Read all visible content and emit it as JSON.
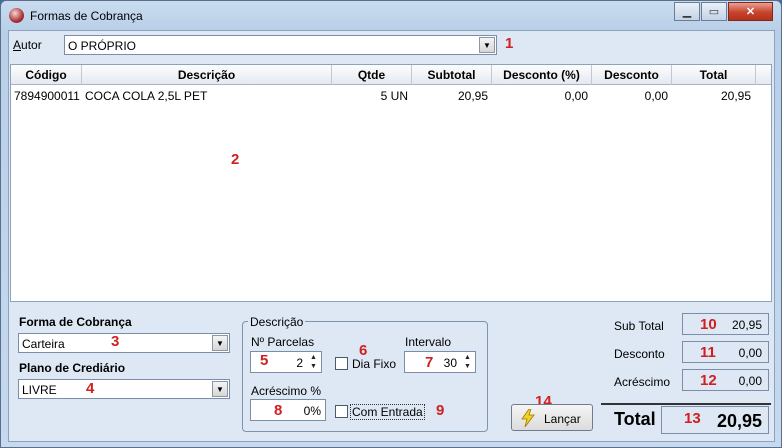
{
  "window": {
    "title": "Formas de Cobrança"
  },
  "autor": {
    "label": "Autor",
    "accesskey": "A",
    "rest": "utor",
    "value": "O PRÓPRIO"
  },
  "grid": {
    "columns": [
      "Código",
      "Descrição",
      "Qtde",
      "Subtotal",
      "Desconto (%)",
      "Desconto",
      "Total"
    ],
    "rows": [
      {
        "codigo": "7894900011",
        "descricao": "COCA COLA 2,5L PET",
        "qtde": "5 UN",
        "subtotal": "20,95",
        "desconto_pct": "0,00",
        "desconto": "0,00",
        "total": "20,95"
      }
    ]
  },
  "forma_cobranca": {
    "label": "Forma de Cobrança",
    "value": "Carteira"
  },
  "plano_crediario": {
    "label": "Plano de Crediário",
    "value": "LIVRE"
  },
  "descricao_group": {
    "legend": "Descrição",
    "parcelas_label": "Nº Parcelas",
    "parcelas_value": "2",
    "dia_fixo_label": "Dia Fixo",
    "intervalo_label": "Intervalo",
    "intervalo_value": "30",
    "acrescimo_label": "Acréscimo %",
    "acrescimo_value": "0%",
    "com_entrada_label": "Com Entrada"
  },
  "lancar_button": {
    "label": "Lançar"
  },
  "summary": {
    "subtotal_label": "Sub Total",
    "subtotal_value": "20,95",
    "desconto_label": "Desconto",
    "desconto_value": "0,00",
    "acrescimo_label": "Acréscimo",
    "acrescimo_value": "0,00",
    "total_label": "Total",
    "total_value": "20,95"
  },
  "markers": [
    "1",
    "2",
    "3",
    "4",
    "5",
    "6",
    "7",
    "8",
    "9",
    "10",
    "11",
    "12",
    "13",
    "14"
  ],
  "colors": {
    "marker": "#d02020",
    "window_frame": "#b9cfe8",
    "client_bg": "#dde8f4"
  }
}
